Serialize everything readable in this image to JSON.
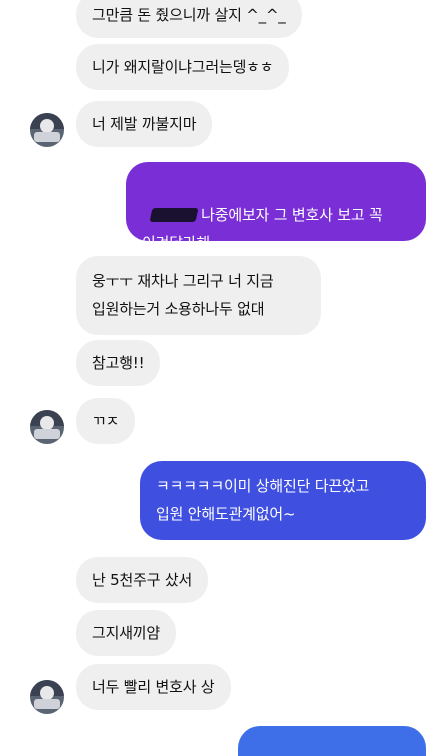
{
  "colors": {
    "incoming_bg": "#efefef",
    "outgoing_purple": "#7a2fd6",
    "outgoing_blue": "#3f4fe0"
  },
  "messages": [
    {
      "side": "in",
      "text": "그만큼 돈 줬으니까 살지 ^_^_"
    },
    {
      "side": "in",
      "text": "니가 왜지랄이냐그러는뎅ㅎㅎ"
    },
    {
      "side": "in",
      "text": "너 제발 까불지마"
    },
    {
      "side": "out",
      "text": "나중에보자 그 변호사 보고 꼭\n이겨달라해"
    },
    {
      "side": "in",
      "text": "웅ㅜㅜ 재차나 그리구 너 지금\n입원하는거 소용하나두 없대"
    },
    {
      "side": "in",
      "text": "참고행!!"
    },
    {
      "side": "in",
      "text": "ㄲㅈ"
    },
    {
      "side": "out",
      "text": "ㅋㅋㅋㅋㅋ이미 상해진단 다끈었고\n입원 안해도관계없어~"
    },
    {
      "side": "in",
      "text": "난 5천주구 샀서"
    },
    {
      "side": "in",
      "text": "그지새끼얌"
    },
    {
      "side": "in",
      "text": "너두 빨리 변호사 상"
    }
  ]
}
